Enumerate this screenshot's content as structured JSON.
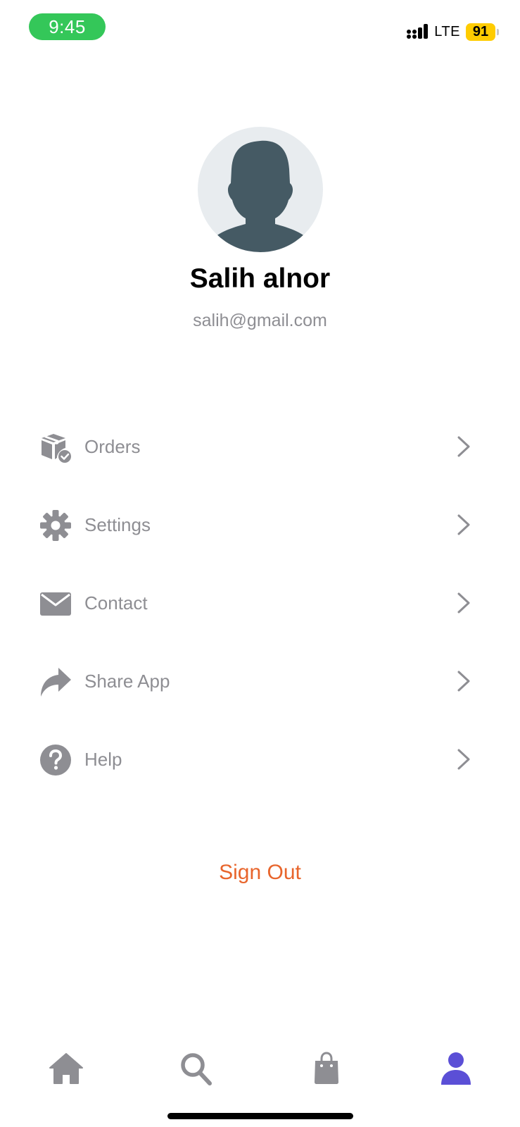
{
  "status_bar": {
    "time": "9:45",
    "network": "LTE",
    "battery": "91",
    "colors": {
      "time_pill": "#34c759",
      "battery": "#ffcc00"
    }
  },
  "profile": {
    "name": "Salih alnor",
    "email": "salih@gmail.com",
    "avatar_icon": "person-silhouette-icon"
  },
  "menu": {
    "items": [
      {
        "label": "Orders",
        "icon": "package-check-icon"
      },
      {
        "label": "Settings",
        "icon": "gear-icon"
      },
      {
        "label": "Contact",
        "icon": "envelope-icon"
      },
      {
        "label": "Share App",
        "icon": "share-arrow-icon"
      },
      {
        "label": "Help",
        "icon": "question-circle-icon"
      }
    ]
  },
  "sign_out": {
    "label": "Sign Out",
    "color": "#e8652c"
  },
  "tab_bar": {
    "tabs": [
      {
        "icon": "home-icon",
        "active": false
      },
      {
        "icon": "search-icon",
        "active": false
      },
      {
        "icon": "shopping-bag-icon",
        "active": false
      },
      {
        "icon": "profile-icon",
        "active": true
      }
    ],
    "colors": {
      "active": "#5b4fd6",
      "inactive": "#8e8e93"
    }
  }
}
